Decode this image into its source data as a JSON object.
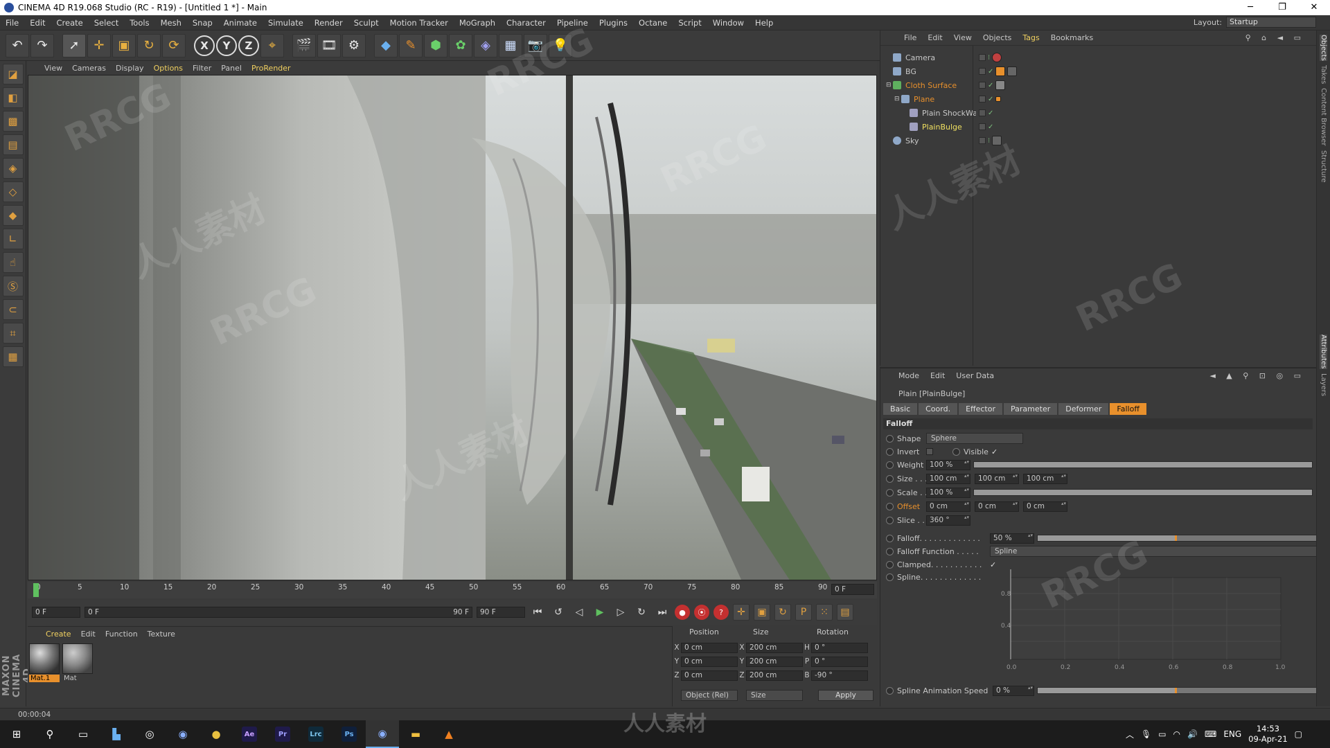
{
  "window": {
    "title": "CINEMA 4D R19.068 Studio (RC - R19) - [Untitled 1 *] - Main",
    "minimize": "─",
    "maximize": "❐",
    "close": "✕"
  },
  "menubar": {
    "items": [
      "File",
      "Edit",
      "Create",
      "Select",
      "Tools",
      "Mesh",
      "Snap",
      "Animate",
      "Simulate",
      "Render",
      "Sculpt",
      "Motion Tracker",
      "MoGraph",
      "Character",
      "Pipeline",
      "Plugins",
      "Octane",
      "Script",
      "Window",
      "Help"
    ],
    "layout_label": "Layout:",
    "layout_value": "Startup"
  },
  "toolbar": {
    "icons": [
      "undo-icon",
      "redo-icon",
      "live-select-icon",
      "move-icon",
      "scale-icon",
      "rotate-icon",
      "recent-tool-icon",
      "x-axis-icon",
      "y-axis-icon",
      "z-axis-icon",
      "world-coordinates-icon",
      "render-view-icon",
      "render-picture-viewer-icon",
      "edit-render-settings-icon",
      "cube-icon",
      "pen-icon",
      "subdivision-icon",
      "cloner-icon",
      "deformer-icon",
      "floor-icon",
      "camera-icon",
      "light-icon"
    ],
    "axis_x": "X",
    "axis_y": "Y",
    "axis_z": "Z"
  },
  "viewport": {
    "menu": [
      "View",
      "Cameras",
      "Display",
      "Options",
      "Filter",
      "Panel",
      "ProRender"
    ]
  },
  "timeline": {
    "ticks": [
      "0",
      "5",
      "10",
      "15",
      "20",
      "25",
      "30",
      "35",
      "40",
      "45",
      "50",
      "55",
      "60",
      "65",
      "70",
      "75",
      "80",
      "85",
      "90"
    ],
    "current_frame": "0 F"
  },
  "playbar": {
    "start": "0 F",
    "range_start": "0 F",
    "range_end": "90 F",
    "end": "90 F"
  },
  "material_manager": {
    "menu": [
      "Create",
      "Edit",
      "Function",
      "Texture"
    ],
    "materials": [
      {
        "name": "Mat.1",
        "selected": true
      },
      {
        "name": "Mat",
        "selected": false
      }
    ]
  },
  "status": {
    "time": "00:00:04"
  },
  "coordinates": {
    "headers": [
      "Position",
      "Size",
      "Rotation"
    ],
    "rows": [
      {
        "axis": "X",
        "pos": "0 cm",
        "saxis": "X",
        "size": "200 cm",
        "raxis": "H",
        "rot": "0 °"
      },
      {
        "axis": "Y",
        "pos": "0 cm",
        "saxis": "Y",
        "size": "200 cm",
        "raxis": "P",
        "rot": "0 °"
      },
      {
        "axis": "Z",
        "pos": "0 cm",
        "saxis": "Z",
        "size": "200 cm",
        "raxis": "B",
        "rot": "-90 °"
      }
    ],
    "mode": "Object (Rel)",
    "size_mode": "Size",
    "apply": "Apply"
  },
  "object_manager": {
    "menu": [
      "File",
      "Edit",
      "View",
      "Objects",
      "Tags",
      "Bookmarks"
    ],
    "objects": [
      {
        "name": "Camera",
        "indent": 0,
        "color": "#8fa8c8",
        "highlight": false
      },
      {
        "name": "BG",
        "indent": 0,
        "color": "#8fa8c8",
        "highlight": false
      },
      {
        "name": "Cloth Surface",
        "indent": 0,
        "color": "#5fb05f",
        "highlight": true
      },
      {
        "name": "Plane",
        "indent": 1,
        "color": "#8fa8c8",
        "highlight": true
      },
      {
        "name": "Plain ShockWa",
        "indent": 2,
        "color": "#a0a0c0",
        "highlight": false
      },
      {
        "name": "PlainBulge",
        "indent": 2,
        "color": "#a0a0c0",
        "highlight": "yellow"
      },
      {
        "name": "Sky",
        "indent": 0,
        "color": "#8fa8c8",
        "highlight": false
      }
    ]
  },
  "side_tabs": [
    "Objects",
    "Takes",
    "Content Browser",
    "Structure",
    "Attributes",
    "Layers"
  ],
  "attributes": {
    "menu": [
      "Mode",
      "Edit",
      "User Data"
    ],
    "title": "Plain [PlainBulge]",
    "tabs": [
      "Basic",
      "Coord.",
      "Effector",
      "Parameter",
      "Deformer",
      "Falloff"
    ],
    "active_tab": "Falloff",
    "section": "Falloff",
    "shape_label": "Shape",
    "shape_value": "Sphere",
    "invert_label": "Invert",
    "visible_label": "Visible",
    "weight_label": "Weight",
    "weight_value": "100 %",
    "weight_fill": 1.0,
    "size_label": "Size . . .",
    "size_values": [
      "100 cm",
      "100 cm",
      "100 cm"
    ],
    "scale_label": "Scale . .",
    "scale_value": "100 %",
    "scale_fill": 1.0,
    "offset_label": "Offset",
    "offset_values": [
      "0 cm",
      "0 cm",
      "0 cm"
    ],
    "slice_label": "Slice . .",
    "slice_value": "360 °",
    "falloff_label": "Falloff. . . . . . . . . . . . .",
    "falloff_value": "50 %",
    "falloff_fill": 0.5,
    "function_label": "Falloff Function . . . . .",
    "function_value": "Spline",
    "clamped_label": "Clamped. . . . . . . . . . .",
    "spline_label": "Spline. . . . . . . . . . . . .",
    "graph_y_ticks": [
      "0.8",
      "0.4"
    ],
    "graph_x_ticks": [
      "0.0",
      "0.2",
      "0.4",
      "0.6",
      "0.8",
      "1.0"
    ],
    "spline_speed_label": "Spline Animation Speed",
    "spline_speed_value": "0 %",
    "spline_speed_fill": 0.5
  },
  "taskbar": {
    "apps": [
      {
        "name": "start-icon",
        "label": "⊞"
      },
      {
        "name": "search-icon",
        "label": "⚲"
      },
      {
        "name": "task-view-icon",
        "label": "▭"
      },
      {
        "name": "explorer-pin-icon",
        "label": "▙"
      },
      {
        "name": "cinema4d-icon",
        "label": "◎"
      },
      {
        "name": "c4d-icon",
        "label": "◉"
      },
      {
        "name": "chrome-icon",
        "label": "●"
      },
      {
        "name": "after-effects-icon",
        "label": "Ae"
      },
      {
        "name": "premiere-icon",
        "label": "Pr"
      },
      {
        "name": "lightroom-icon",
        "label": "Lrc"
      },
      {
        "name": "photoshop-icon",
        "label": "Ps"
      },
      {
        "name": "cinema4d-active-icon",
        "label": "◉"
      },
      {
        "name": "folder-icon",
        "label": "▬"
      },
      {
        "name": "vlc-icon",
        "label": "▲"
      }
    ],
    "lang": "ENG",
    "time": "14:53",
    "date": "09-Apr-21"
  },
  "watermarks": [
    "RRCG",
    "人人素材"
  ]
}
